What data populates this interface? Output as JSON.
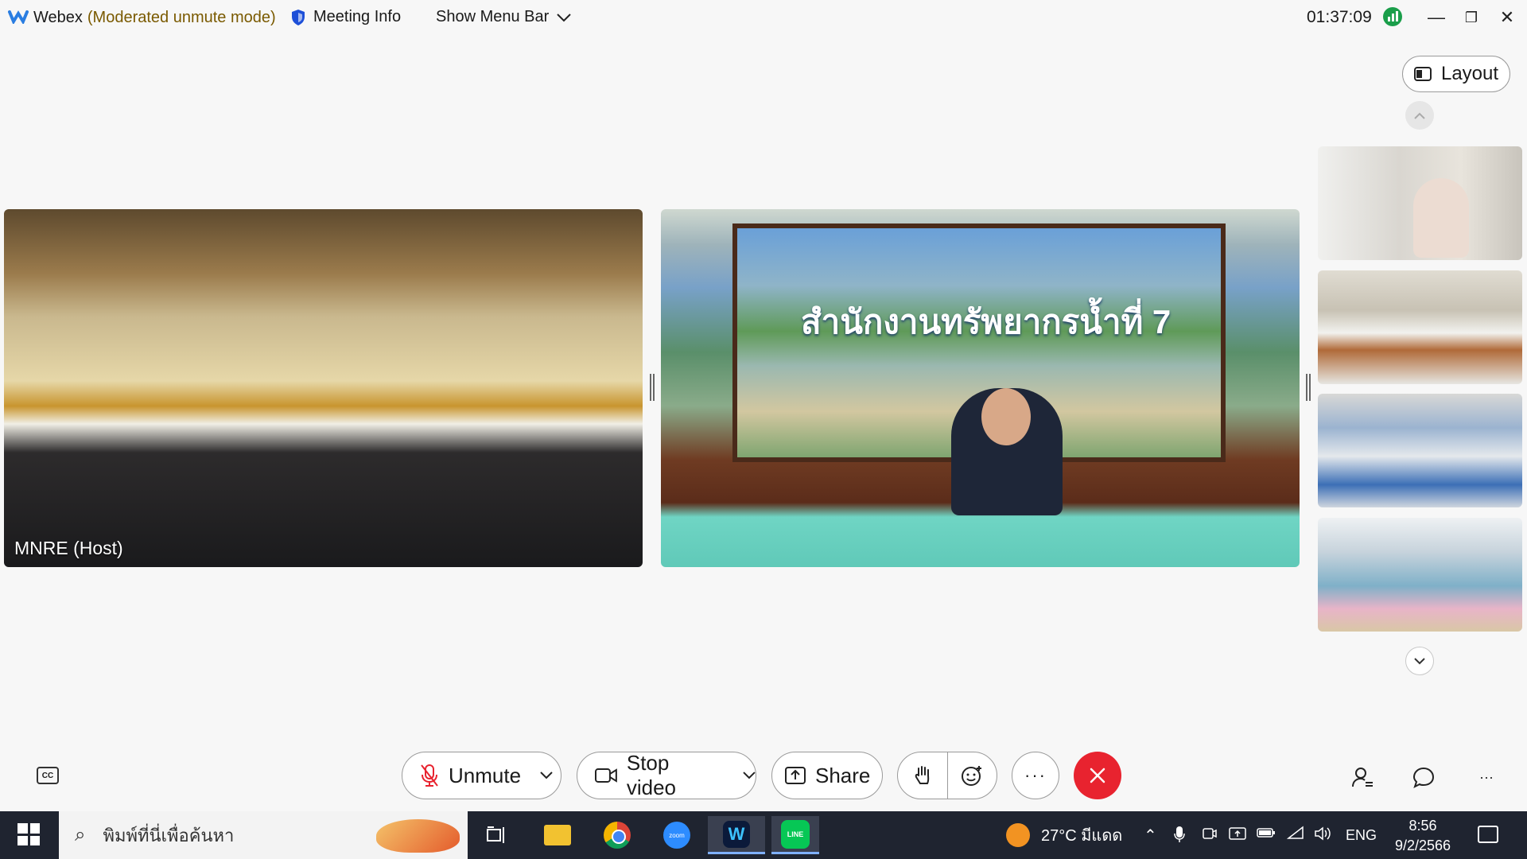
{
  "titlebar": {
    "app_name": "Webex",
    "mode": "(Moderated unmute mode)",
    "meeting_info": "Meeting Info",
    "show_menu_bar": "Show Menu Bar",
    "clock": "01:37:09"
  },
  "layout_button": {
    "label": "Layout"
  },
  "main_tiles": [
    {
      "name": "MNRE (Host)"
    },
    {
      "banner_text": "สำนักงานทรัพยากรน้ำที่ 7"
    }
  ],
  "controls": {
    "unmute": "Unmute",
    "stop_video": "Stop video",
    "share": "Share",
    "more": "···"
  },
  "taskbar": {
    "search_placeholder": "พิมพ์ที่นี่เพื่อค้นหา",
    "weather": "27°C มีแดด",
    "language": "ENG",
    "time": "8:56",
    "date": "9/2/2566",
    "zoom_label": "zoom",
    "line_label": "LINE"
  },
  "colors": {
    "leave": "#e8232f",
    "mode_text": "#7a5a00",
    "taskbar_bg": "#1f2430"
  }
}
